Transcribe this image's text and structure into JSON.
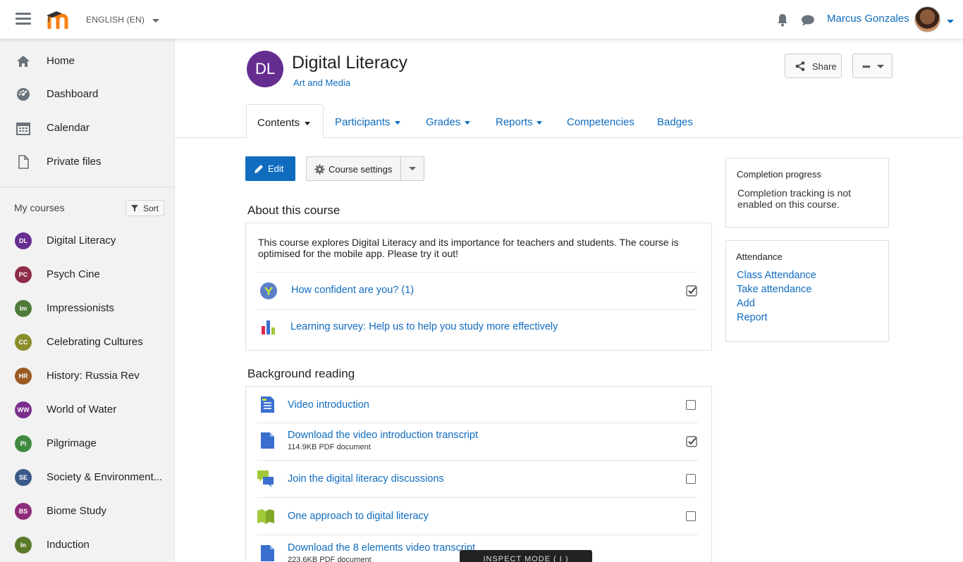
{
  "header": {
    "language": "ENGLISH (EN)",
    "username": "Marcus Gonzales"
  },
  "sidebar": {
    "nav": [
      {
        "label": "Home",
        "icon": "home-icon"
      },
      {
        "label": "Dashboard",
        "icon": "dashboard-icon"
      },
      {
        "label": "Calendar",
        "icon": "calendar-icon"
      },
      {
        "label": "Private files",
        "icon": "file-icon"
      }
    ],
    "my_courses_label": "My courses",
    "sort_label": "Sort",
    "courses": [
      {
        "abbr": "DL",
        "label": "Digital Literacy",
        "color": "#662d91"
      },
      {
        "abbr": "PC",
        "label": "Psych Cine",
        "color": "#8e2c48"
      },
      {
        "abbr": "Im",
        "label": "Impressionists",
        "color": "#4f7a3a"
      },
      {
        "abbr": "CC",
        "label": "Celebrating Cultures",
        "color": "#8a8c2a"
      },
      {
        "abbr": "HR",
        "label": "History: Russia Rev",
        "color": "#9a5b24"
      },
      {
        "abbr": "WW",
        "label": "World of Water",
        "color": "#7a2e8e"
      },
      {
        "abbr": "Pi",
        "label": "Pilgrimage",
        "color": "#3f8a3f"
      },
      {
        "abbr": "SE",
        "label": "Society & Environment...",
        "color": "#3b5a8a"
      },
      {
        "abbr": "BS",
        "label": "Biome Study",
        "color": "#8e2c7a"
      },
      {
        "abbr": "In",
        "label": "Induction",
        "color": "#5a7a2a"
      }
    ]
  },
  "course": {
    "abbr": "DL",
    "title": "Digital Literacy",
    "category": "Art and Media",
    "share_label": "Share",
    "more_label": "•••"
  },
  "tabs": [
    {
      "label": "Contents",
      "dropdown": true,
      "active": true
    },
    {
      "label": "Participants",
      "dropdown": true
    },
    {
      "label": "Grades",
      "dropdown": true
    },
    {
      "label": "Reports",
      "dropdown": true
    },
    {
      "label": "Competencies",
      "dropdown": false
    },
    {
      "label": "Badges",
      "dropdown": false
    }
  ],
  "toolbar": {
    "edit_label": "Edit",
    "settings_label": "Course settings"
  },
  "about": {
    "title": "About this course",
    "description": "This course explores Digital Literacy and its importance for teachers and students. The course is optimised for the mobile app. Please try it out!",
    "activities": [
      {
        "label": "How confident are you? (1)",
        "icon": "choice-icon",
        "completed": true
      },
      {
        "label": "Learning survey: Help us to help you study more effectively",
        "icon": "survey-icon"
      }
    ]
  },
  "background": {
    "title": "Background reading",
    "activities": [
      {
        "label": "Video introduction",
        "icon": "page-icon",
        "completed": false
      },
      {
        "label": "Download the video introduction transcript",
        "sub": "114.9KB PDF document",
        "icon": "file-icon",
        "completed": true
      },
      {
        "label": "Join the digital literacy discussions",
        "icon": "forum-icon",
        "completed": false
      },
      {
        "label": "One approach to digital literacy",
        "icon": "book-icon",
        "completed": false
      },
      {
        "label": "Download the 8 elements video transcript",
        "sub": "223.6KB PDF document",
        "icon": "file-icon"
      }
    ]
  },
  "blocks": {
    "completion": {
      "title": "Completion progress",
      "text": "Completion tracking is not enabled on this course."
    },
    "attendance": {
      "title": "Attendance",
      "links": [
        "Class Attendance",
        "Take attendance",
        "Add",
        "Report"
      ]
    }
  },
  "inspect_label": "INSPECT MODE ( I )"
}
